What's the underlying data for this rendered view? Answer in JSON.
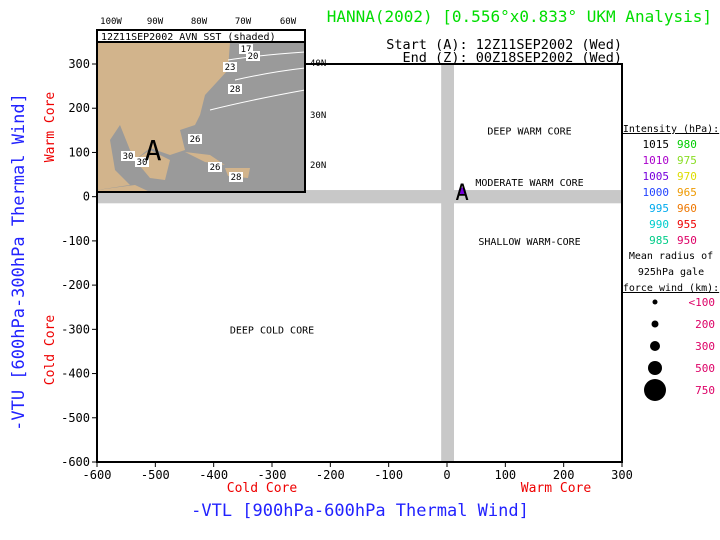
{
  "title": "HANNA(2002) [0.556°x0.833° UKM Analysis]",
  "start_label": "Start (A): 12Z11SEP2002 (Wed)",
  "end_label": "End (Z): 00Z18SEP2002 (Wed)",
  "colors": {
    "title": "#00dd00",
    "axis_label": "#2222ff",
    "core_label": "#ee0000",
    "band": "#c8c8c8",
    "land": "#d2b48c",
    "sea": "#9a9a9a"
  },
  "inset": {
    "title": "12Z11SEP2002 AVN SST (shaded)",
    "lon_labels": [
      "100W",
      "90W",
      "80W",
      "70W",
      "60W"
    ],
    "lat_labels": [
      "40N",
      "30N",
      "20N"
    ],
    "contour_labels": [
      "17",
      "20",
      "23",
      "28",
      "26",
      "26",
      "28",
      "30",
      "30"
    ],
    "start_marker": "A"
  },
  "chart_data": {
    "type": "scatter",
    "xlabel": "-VTL [900hPa-600hPa Thermal Wind]",
    "ylabel": "-VTU [600hPa-300hPa Thermal Wind]",
    "xlim": [
      -600,
      300
    ],
    "ylim": [
      -600,
      300
    ],
    "xticks": [
      -600,
      -500,
      -400,
      -300,
      -200,
      -100,
      0,
      100,
      200,
      300
    ],
    "yticks": [
      300,
      200,
      100,
      0,
      -100,
      -200,
      -300,
      -400,
      -500,
      -600
    ],
    "x_side_labels": {
      "left": "Cold Core",
      "right": "Warm Core"
    },
    "y_side_labels": {
      "top": "Warm Core",
      "bottom": "Cold Core"
    },
    "regions": [
      {
        "label": "DEEP WARM CORE",
        "x": 150,
        "y": 150
      },
      {
        "label": "MODERATE WARM CORE",
        "x": 150,
        "y": 15
      },
      {
        "label": "SHALLOW WARM-CORE",
        "x": 150,
        "y": -100
      },
      {
        "label": "DEEP COLD CORE",
        "x": -300,
        "y": -300
      }
    ],
    "points": [
      {
        "label": "A",
        "x": 26,
        "y": 15,
        "pressure_hPa": 1005,
        "color": "#7700dd",
        "gale_radius_km": "<100"
      }
    ],
    "legend": {
      "intensity_title": "Intensity (hPa):",
      "intensity": [
        [
          "1015",
          "#000000",
          "980",
          "#00cc00"
        ],
        [
          "1010",
          "#aa00cc",
          "975",
          "#88dd22"
        ],
        [
          "1005",
          "#7700dd",
          "970",
          "#dddd00"
        ],
        [
          "1000",
          "#2244ff",
          "965",
          "#ee9900"
        ],
        [
          "995",
          "#00aaee",
          "960",
          "#ee7700"
        ],
        [
          "990",
          "#00cccc",
          "955",
          "#ee0000"
        ],
        [
          "985",
          "#00cc88",
          "950",
          "#dd0066"
        ]
      ],
      "radius_title": [
        "Mean radius of",
        "925hPa gale",
        "force wind (km):"
      ],
      "radii": [
        "<100",
        "200",
        "300",
        "500",
        "750"
      ],
      "radius_color": "#dd0066"
    }
  }
}
